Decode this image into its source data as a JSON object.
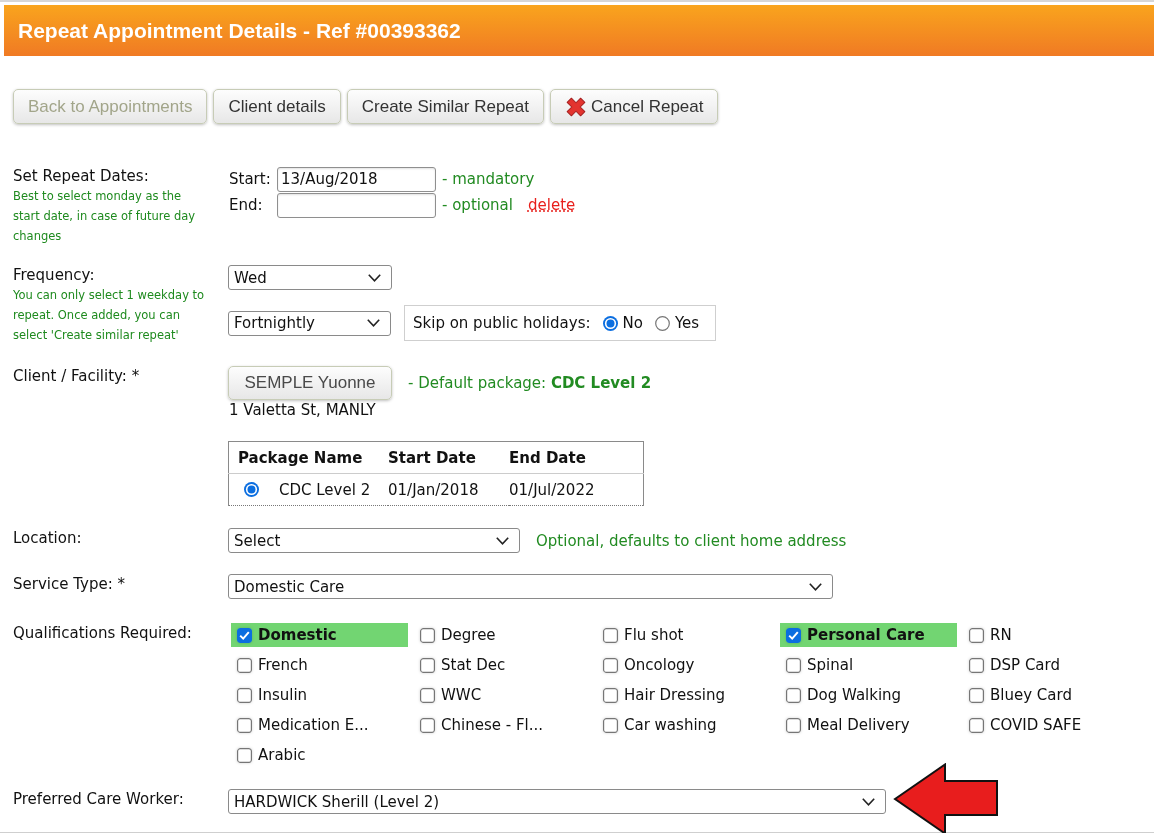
{
  "header": {
    "title": "Repeat Appointment Details - Ref #00393362"
  },
  "toolbar": {
    "buttons": [
      {
        "label": "Back to Appointments",
        "kind": "plain",
        "disabled": true
      },
      {
        "label": "Client details",
        "kind": "plain",
        "disabled": false
      },
      {
        "label": "Create Similar Repeat",
        "kind": "plain",
        "disabled": false
      },
      {
        "label": "Cancel Repeat",
        "kind": "cancel",
        "disabled": false
      }
    ]
  },
  "repeat_dates": {
    "label": "Set Repeat Dates:",
    "hint": "Best to select monday as the start date, in case of future day changes",
    "start": {
      "label": "Start:",
      "value": "13/Aug/2018",
      "note": "- mandatory"
    },
    "end": {
      "label": "End:",
      "note": "- optional",
      "link": "delete"
    }
  },
  "frequency": {
    "label": "Frequency:",
    "hint": "You can only select 1 weekday to repeat. Once added, you can select 'Create similar repeat'",
    "weekday": {
      "value": "Wed"
    },
    "interval": {
      "value": "Fortnightly"
    },
    "skip_public_holidays": {
      "label": "Skip on public holidays:",
      "options": [
        {
          "label": "No",
          "selected": true
        },
        {
          "label": "Yes",
          "selected": false
        }
      ]
    }
  },
  "client": {
    "label": "Client / Facility: *",
    "button": "SEMPLE Yuonne",
    "default_package": "- Default package: **CDC Level 2**",
    "address": "1 Valetta St, MANLY",
    "packages": {
      "columns": [
        "Package Name",
        "Start Date",
        "End Date"
      ],
      "rows": [
        {
          "selected": true,
          "cells": [
            "CDC Level 2",
            "01/Jan/2018",
            "01/Jul/2022"
          ]
        }
      ]
    }
  },
  "location": {
    "label": "Location:",
    "value": "Select",
    "note": "Optional, defaults to client home address"
  },
  "service_type": {
    "label": "Service Type: *",
    "value": "Domestic Care"
  },
  "qualifications": {
    "label": "Qualifications Required:",
    "items": [
      {
        "label": "Domestic",
        "checked": true
      },
      {
        "label": "Degree",
        "checked": false
      },
      {
        "label": "Flu shot",
        "checked": false
      },
      {
        "label": "Personal Care",
        "checked": true
      },
      {
        "label": "RN",
        "checked": false
      },
      {
        "label": "French",
        "checked": false
      },
      {
        "label": "Stat Dec",
        "checked": false
      },
      {
        "label": "Oncology",
        "checked": false
      },
      {
        "label": "Spinal",
        "checked": false
      },
      {
        "label": "DSP Card",
        "checked": false
      },
      {
        "label": "Insulin",
        "checked": false
      },
      {
        "label": "WWC",
        "checked": false
      },
      {
        "label": "Hair Dressing",
        "checked": false
      },
      {
        "label": "Dog Walking",
        "checked": false
      },
      {
        "label": "Bluey Card",
        "checked": false
      },
      {
        "label": "Medication E...",
        "checked": false
      },
      {
        "label": "Chinese - Fl...",
        "checked": false
      },
      {
        "label": "Car washing",
        "checked": false
      },
      {
        "label": "Meal Delivery",
        "checked": false
      },
      {
        "label": "COVID SAFE",
        "checked": false
      },
      {
        "label": "Arabic",
        "checked": false
      }
    ]
  },
  "preferred_care_worker": {
    "label": "Preferred Care Worker:",
    "value": "HARDWICK Sherill (Level 2)"
  }
}
